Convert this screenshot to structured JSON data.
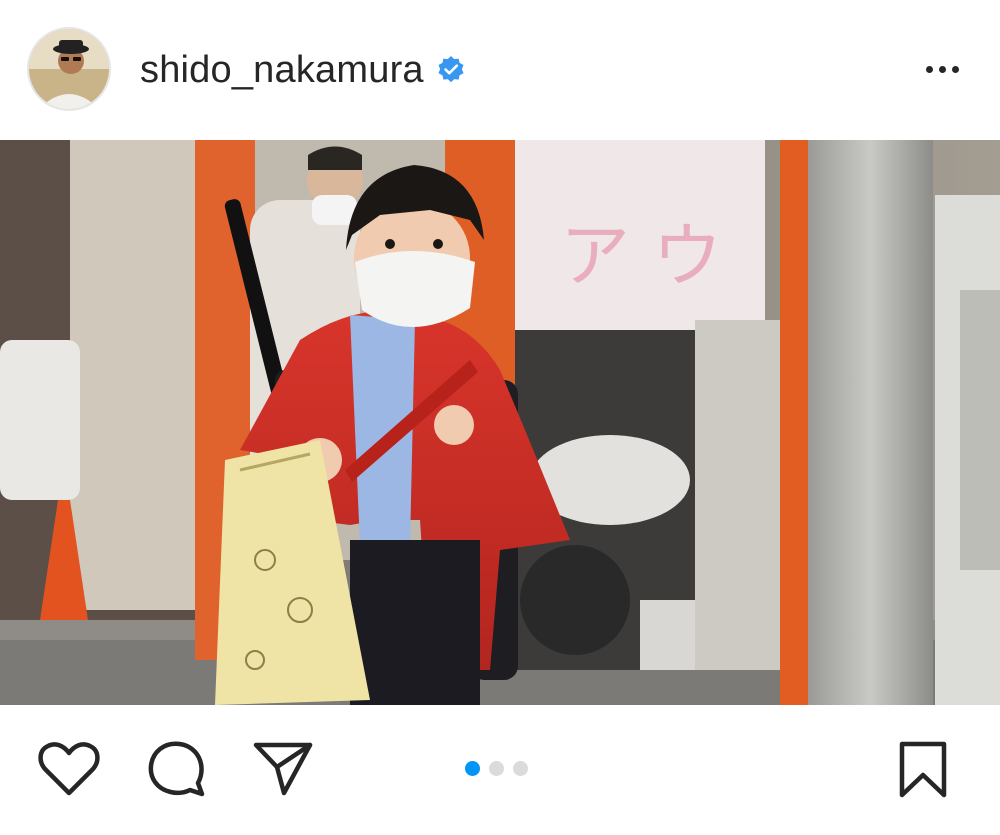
{
  "post": {
    "username": "shido_nakamura",
    "verified_icon": "verified-badge-icon",
    "more_icon": "more-options-icon"
  },
  "actions": {
    "like_icon": "heart-icon",
    "comment_icon": "comment-icon",
    "share_icon": "paper-plane-icon",
    "save_icon": "bookmark-icon"
  },
  "carousel": {
    "total": 3,
    "active_index": 0,
    "active_color": "#0095f6",
    "inactive_color": "#dbdbdb"
  },
  "colors": {
    "text": "#262626",
    "verified": "#3897f0",
    "background": "#ffffff"
  }
}
